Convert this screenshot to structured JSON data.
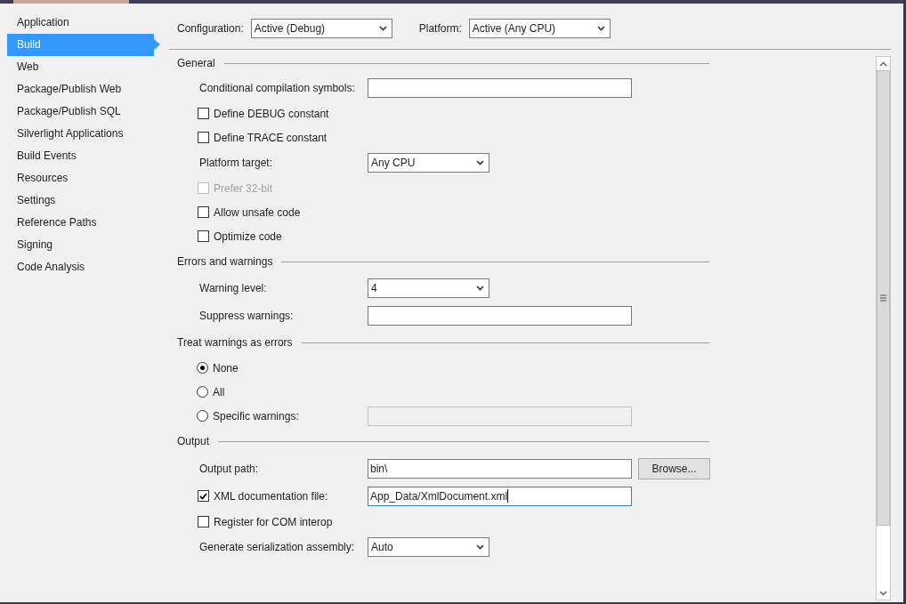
{
  "sidebar": {
    "items": [
      {
        "label": "Application",
        "selected": false
      },
      {
        "label": "Build",
        "selected": true
      },
      {
        "label": "Web",
        "selected": false
      },
      {
        "label": "Package/Publish Web",
        "selected": false
      },
      {
        "label": "Package/Publish SQL",
        "selected": false
      },
      {
        "label": "Silverlight Applications",
        "selected": false
      },
      {
        "label": "Build Events",
        "selected": false
      },
      {
        "label": "Resources",
        "selected": false
      },
      {
        "label": "Settings",
        "selected": false
      },
      {
        "label": "Reference Paths",
        "selected": false
      },
      {
        "label": "Signing",
        "selected": false
      },
      {
        "label": "Code Analysis",
        "selected": false
      }
    ]
  },
  "configuration": {
    "label": "Configuration:",
    "value": "Active (Debug)"
  },
  "platform": {
    "label": "Platform:",
    "value": "Active (Any CPU)"
  },
  "sections": [
    {
      "title": "General",
      "rows": [
        {
          "kind": "text",
          "label": "Conditional compilation symbols:"
        },
        {
          "kind": "check",
          "label": "Define DEBUG constant",
          "checked": false,
          "disabled": false
        },
        {
          "kind": "check",
          "label": "Define TRACE constant",
          "checked": false,
          "disabled": false
        },
        {
          "kind": "select",
          "label": "Platform target:",
          "value": "Any CPU"
        },
        {
          "kind": "check",
          "label": "Prefer 32-bit",
          "checked": false,
          "disabled": true
        },
        {
          "kind": "check",
          "label": "Allow unsafe code",
          "checked": false,
          "disabled": false
        },
        {
          "kind": "check",
          "label": "Optimize code",
          "checked": false,
          "disabled": false
        }
      ]
    },
    {
      "title": "Errors and warnings",
      "rows": [
        {
          "kind": "select",
          "label": "Warning level:",
          "value": "4"
        },
        {
          "kind": "text",
          "label": "Suppress warnings:"
        }
      ]
    },
    {
      "title": "Treat warnings as errors",
      "rows": [
        {
          "kind": "radio",
          "label": "None",
          "selected": true
        },
        {
          "kind": "radio",
          "label": "All",
          "selected": false
        },
        {
          "kind": "radio",
          "label": "Specific warnings:",
          "selected": false,
          "field": {
            "disabled": true
          }
        }
      ]
    },
    {
      "title": "Output",
      "rows": [
        {
          "kind": "text",
          "label": "Output path:",
          "value": "bin\\",
          "button": "Browse..."
        },
        {
          "kind": "checktext",
          "label": "XML documentation file:",
          "checked": true,
          "value": "App_Data/XmlDocument.xml",
          "focused": true
        },
        {
          "kind": "check",
          "label": "Register for COM interop",
          "checked": false,
          "disabled": false
        },
        {
          "kind": "select",
          "label": "Generate serialization assembly:",
          "value": "Auto"
        }
      ]
    }
  ]
}
